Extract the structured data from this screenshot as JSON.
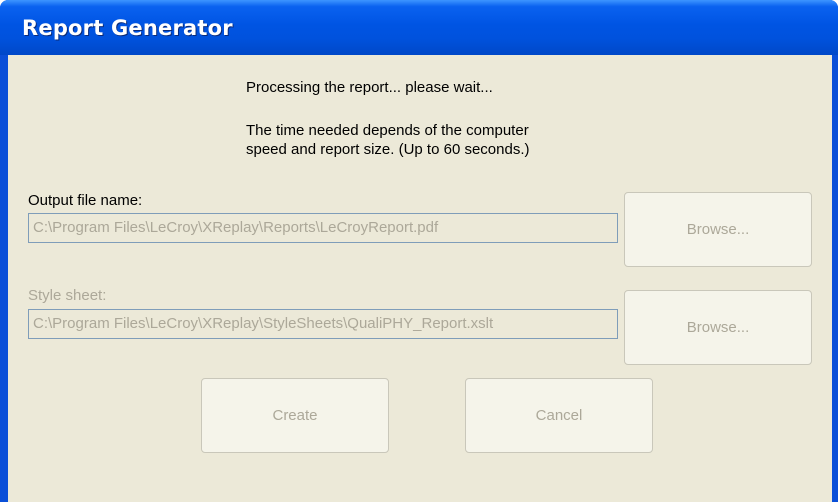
{
  "window": {
    "title": "Report Generator"
  },
  "status": {
    "line1": "Processing the report... please wait...",
    "line2": "The time needed depends of the computer",
    "line3": "speed and report size. (Up to 60 seconds.)"
  },
  "output": {
    "label": "Output file name:",
    "value": "C:\\Program Files\\LeCroy\\XReplay\\Reports\\LeCroyReport.pdf",
    "browse_label": "Browse..."
  },
  "stylesheet": {
    "label": "Style sheet:",
    "value": "C:\\Program Files\\LeCroy\\XReplay\\StyleSheets\\QualiPHY_Report.xslt",
    "browse_label": "Browse..."
  },
  "actions": {
    "create_label": "Create",
    "cancel_label": "Cancel"
  },
  "colors": {
    "titlebar": "#0054e3",
    "dialog_bg": "#ece9d8",
    "disabled_text": "#aca899",
    "field_border": "#7f9db9"
  }
}
